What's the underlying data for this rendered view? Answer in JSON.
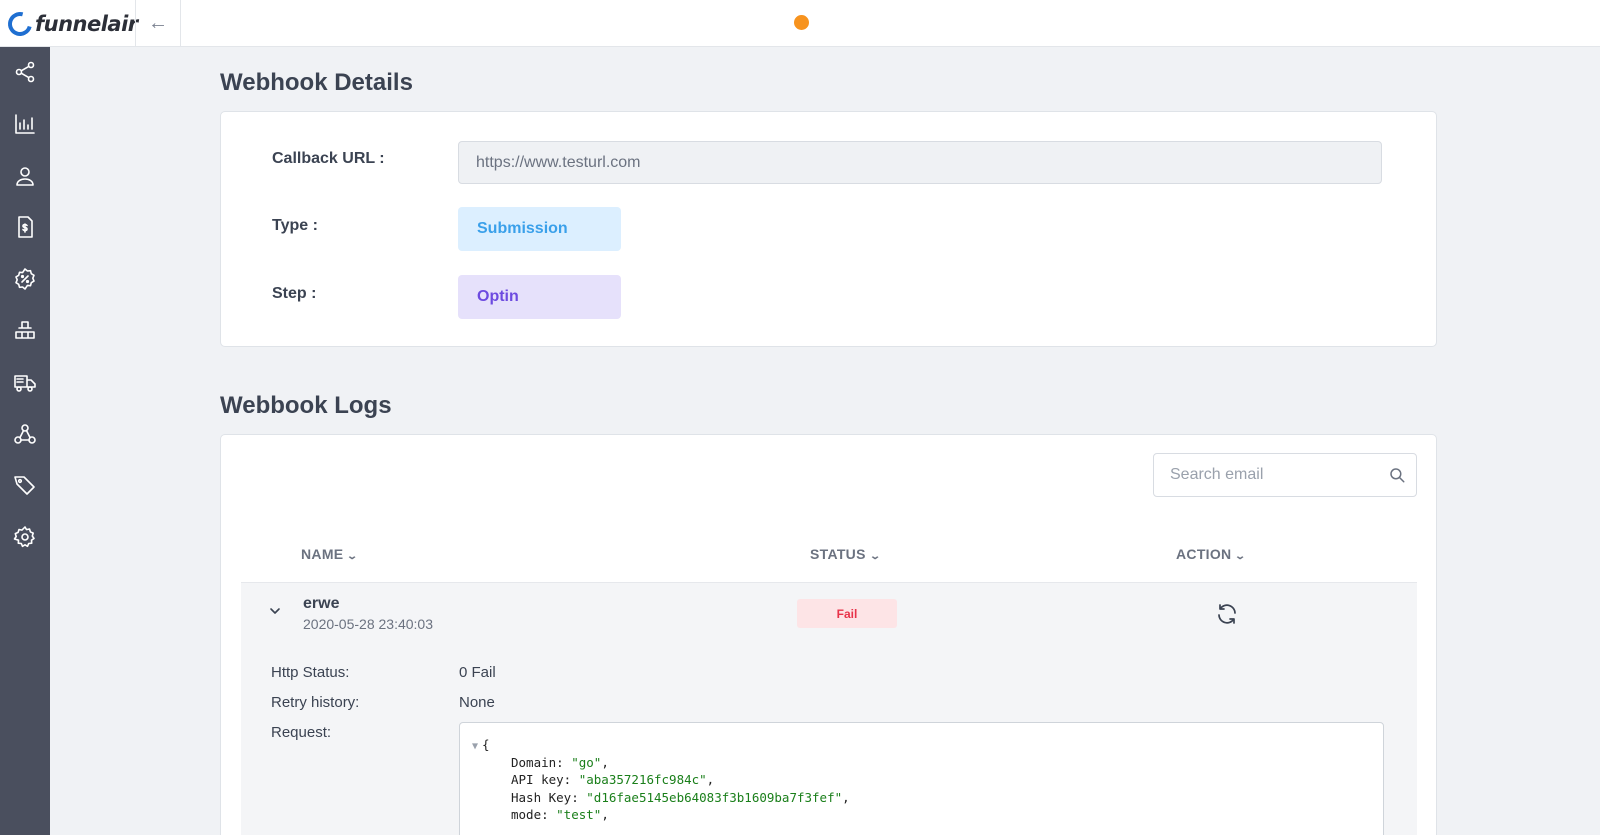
{
  "app": {
    "logo_text": "funnelair"
  },
  "header": {
    "back_icon": "arrow-left-icon",
    "status_dot_color": "#f7931e"
  },
  "sidebar": {
    "items": [
      {
        "icon": "share-nodes-icon"
      },
      {
        "icon": "bar-chart-icon"
      },
      {
        "icon": "user-icon"
      },
      {
        "icon": "invoice-dollar-icon"
      },
      {
        "icon": "discount-badge-icon"
      },
      {
        "icon": "boxes-icon"
      },
      {
        "icon": "delivery-truck-icon"
      },
      {
        "icon": "webhook-icon"
      },
      {
        "icon": "tags-icon"
      },
      {
        "icon": "gear-icon"
      }
    ]
  },
  "webhook_details": {
    "title": "Webhook Details",
    "callback_label": "Callback URL :",
    "callback_value": "https://www.testurl.com",
    "type_label": "Type :",
    "type_value": "Submission",
    "step_label": "Step :",
    "step_value": "Optin"
  },
  "webhook_logs": {
    "title": "Webbook Logs",
    "search_placeholder": "Search email",
    "columns": {
      "name": "NAME",
      "status": "STATUS",
      "action": "ACTION"
    },
    "rows": [
      {
        "name": "erwe",
        "date": "2020-05-28 23:40:03",
        "status": "Fail",
        "details": {
          "http_status_label": "Http Status:",
          "http_status_value": "0 Fail",
          "retry_label": "Retry history:",
          "retry_value": "None",
          "request_label": "Request:",
          "request_open": "{",
          "request_lines": [
            {
              "key": "Domain: ",
              "value": "\"go\"",
              "sep": ","
            },
            {
              "key": "API key: ",
              "value": "\"aba357216fc984c\"",
              "sep": ","
            },
            {
              "key": "Hash Key: ",
              "value": "\"d16fae5145eb64083f3b1609ba7f3fef\"",
              "sep": ","
            },
            {
              "key": "mode: ",
              "value": "\"test\"",
              "sep": ","
            }
          ]
        }
      }
    ]
  }
}
